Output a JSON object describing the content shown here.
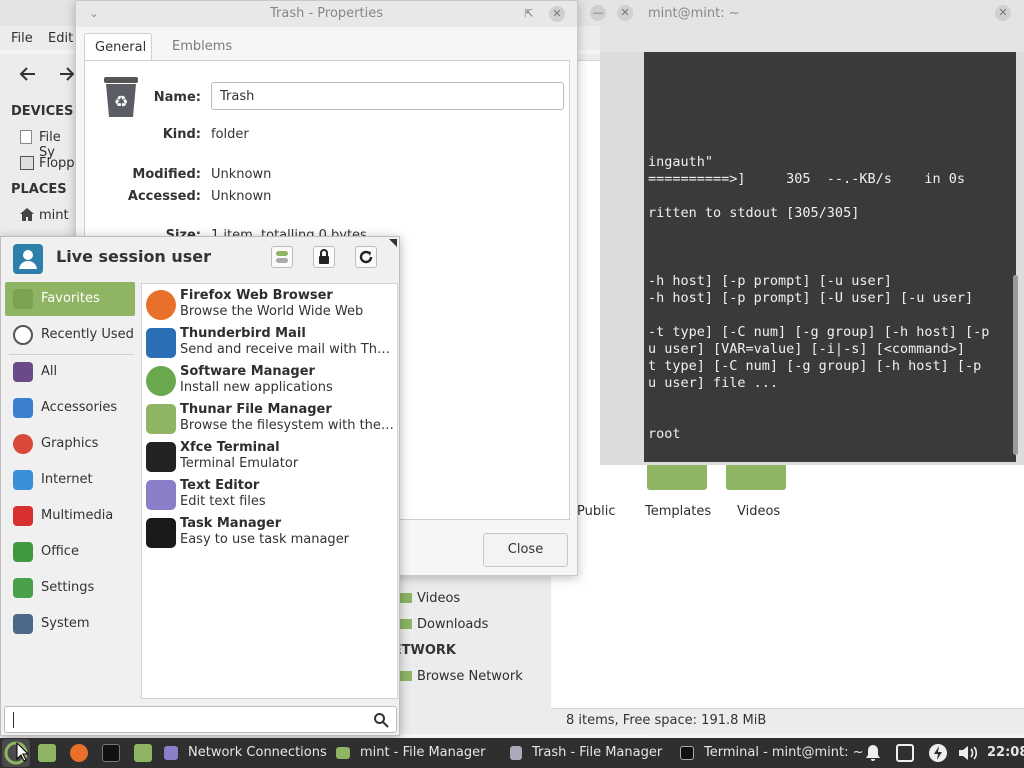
{
  "file_manager": {
    "menu": {
      "file": "File",
      "edit": "Edit"
    },
    "sidebar": {
      "devices_header": "DEVICES",
      "places_header": "PLACES",
      "network_header": "NETWORK",
      "items": [
        "File Sy",
        "Flopp",
        "mint"
      ],
      "lower_items": [
        "Videos",
        "Downloads",
        "Browse Network"
      ]
    },
    "folders": [
      "Public",
      "Templates",
      "Videos"
    ],
    "status": "8 items, Free space: 191.8 MiB"
  },
  "terminal": {
    "title": "mint@mint: ~",
    "lines": [
      "ingauth\"",
      "==========>]     305  --.-KB/s    in 0s",
      "ritten to stdout [305/305]",
      "",
      "-h host] [-p prompt] [-u user]",
      "-h host] [-p prompt] [-U user] [-u user]",
      "",
      "-t type] [-C num] [-g group] [-h host] [-p",
      "u user] [VAR=value] [-i|-s] [<command>]",
      "t type] [-C num] [-g group] [-h host] [-p",
      "u user] file ...",
      "",
      "root"
    ]
  },
  "properties": {
    "title": "Trash - Properties",
    "tabs": {
      "general": "General",
      "emblems": "Emblems"
    },
    "labels": {
      "name": "Name:",
      "kind": "Kind:",
      "modified": "Modified:",
      "accessed": "Accessed:",
      "size": "Size:"
    },
    "values": {
      "name": "Trash",
      "kind": "folder",
      "modified": "Unknown",
      "accessed": "Unknown",
      "size": "1 item, totalling 0 bytes"
    },
    "close_label": "Close"
  },
  "menu": {
    "user": "Live session user",
    "categories": [
      {
        "label": "Favorites",
        "color": "#e8f0dc"
      },
      {
        "label": "Recently Used",
        "color": "#555555"
      },
      {
        "label": "All",
        "color": "#6b4a8a"
      },
      {
        "label": "Accessories",
        "color": "#3b7fd0"
      },
      {
        "label": "Graphics",
        "color": "#d9483b"
      },
      {
        "label": "Internet",
        "color": "#3b8fd9"
      },
      {
        "label": "Multimedia",
        "color": "#d83030"
      },
      {
        "label": "Office",
        "color": "#3f9a3f"
      },
      {
        "label": "Settings",
        "color": "#4aa04a"
      },
      {
        "label": "System",
        "color": "#4b6a8a"
      }
    ],
    "apps": [
      {
        "name": "Firefox Web Browser",
        "desc": "Browse the World Wide Web",
        "color": "#e8702a"
      },
      {
        "name": "Thunderbird Mail",
        "desc": "Send and receive mail with Thunderbird",
        "color": "#2a6fb5"
      },
      {
        "name": "Software Manager",
        "desc": "Install new applications",
        "color": "#6aa84f"
      },
      {
        "name": "Thunar File Manager",
        "desc": "Browse the filesystem with the file manager",
        "color": "#8fb464"
      },
      {
        "name": "Xfce Terminal",
        "desc": "Terminal Emulator",
        "color": "#222222"
      },
      {
        "name": "Text Editor",
        "desc": "Edit text files",
        "color": "#8a7ec8"
      },
      {
        "name": "Task Manager",
        "desc": "Easy to use task manager",
        "color": "#1a1a1a"
      }
    ],
    "search_value": ""
  },
  "taskbar": {
    "items": [
      "Network Connections",
      "mint - File Manager",
      "Trash - File Manager",
      "Terminal - mint@mint: ~"
    ],
    "clock": "22:08"
  },
  "colors": {
    "accent": "#8fb464",
    "taskbar": "#2f2f2f",
    "terminal_bg": "#3a3a3a"
  }
}
